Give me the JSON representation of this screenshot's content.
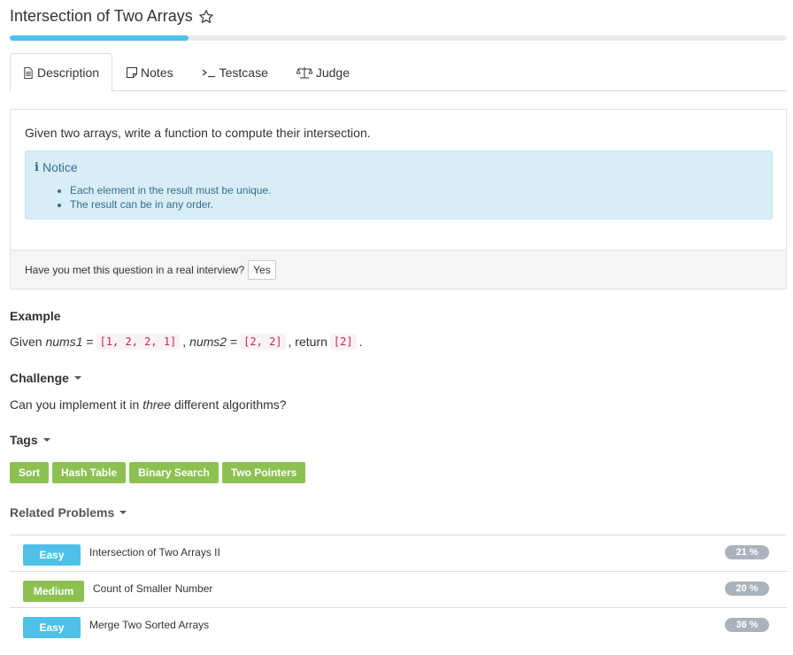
{
  "title": "Intersection of Two Arrays",
  "progress_fraction": 0.23,
  "tabs": [
    {
      "label": "Description",
      "icon": "document-icon"
    },
    {
      "label": "Notes",
      "icon": "note-icon"
    },
    {
      "label": "Testcase",
      "icon": "terminal-icon"
    },
    {
      "label": "Judge",
      "icon": "scale-icon"
    }
  ],
  "description": "Given two arrays, write a function to compute their intersection.",
  "notice": {
    "heading": "Notice",
    "items": [
      "Each element in the result must be unique.",
      "The result can be in any order."
    ]
  },
  "interview": {
    "question": "Have you met this question in a real interview?",
    "button": "Yes"
  },
  "example": {
    "heading": "Example",
    "given": "Given",
    "var1": "nums1",
    "eq": "=",
    "val1": "[1, 2, 2, 1]",
    "comma": ",",
    "var2": "nums2",
    "val2": "[2, 2]",
    "return_text": ", return",
    "result": "[2]",
    "period": "."
  },
  "challenge": {
    "heading": "Challenge",
    "pre": "Can you implement it in",
    "emph": "three",
    "post": "different algorithms?"
  },
  "tags": {
    "heading": "Tags",
    "items": [
      "Sort",
      "Hash Table",
      "Binary Search",
      "Two Pointers"
    ]
  },
  "related": {
    "heading": "Related Problems",
    "items": [
      {
        "difficulty": "Easy",
        "name": "Intersection of Two Arrays II",
        "percent": "21 %"
      },
      {
        "difficulty": "Medium",
        "name": "Count of Smaller Number",
        "percent": "20 %"
      },
      {
        "difficulty": "Easy",
        "name": "Merge Two Sorted Arrays",
        "percent": "36 %"
      }
    ]
  },
  "colors": {
    "accent_blue": "#4fc1e9",
    "accent_green": "#8cc152",
    "notice_bg": "#d9edf7",
    "code_red": "#c7254e"
  }
}
